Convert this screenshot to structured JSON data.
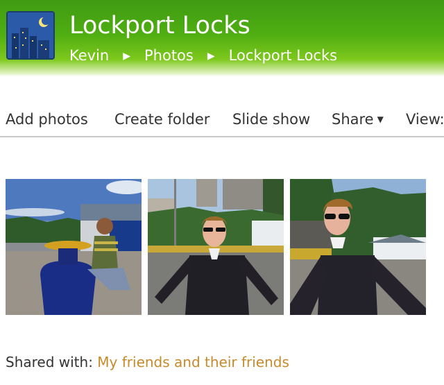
{
  "header": {
    "title": "Lockport Locks",
    "breadcrumbs": [
      {
        "label": "Kevin"
      },
      {
        "label": "Photos"
      },
      {
        "label": "Lockport Locks"
      }
    ],
    "separator": "▶"
  },
  "toolbar": {
    "add_photos": "Add photos",
    "create_folder": "Create folder",
    "slide_show": "Slide show",
    "share": "Share",
    "view": "View:"
  },
  "photos": [
    {
      "icon": "photo-woman-on-bollard"
    },
    {
      "icon": "photo-man-by-bridge"
    },
    {
      "icon": "photo-man-sunglasses"
    }
  ],
  "sharing": {
    "label": "Shared with:",
    "value": "My friends and their friends"
  },
  "colors": {
    "header_green": "#4fae12",
    "link_orange": "#c68a2a"
  }
}
